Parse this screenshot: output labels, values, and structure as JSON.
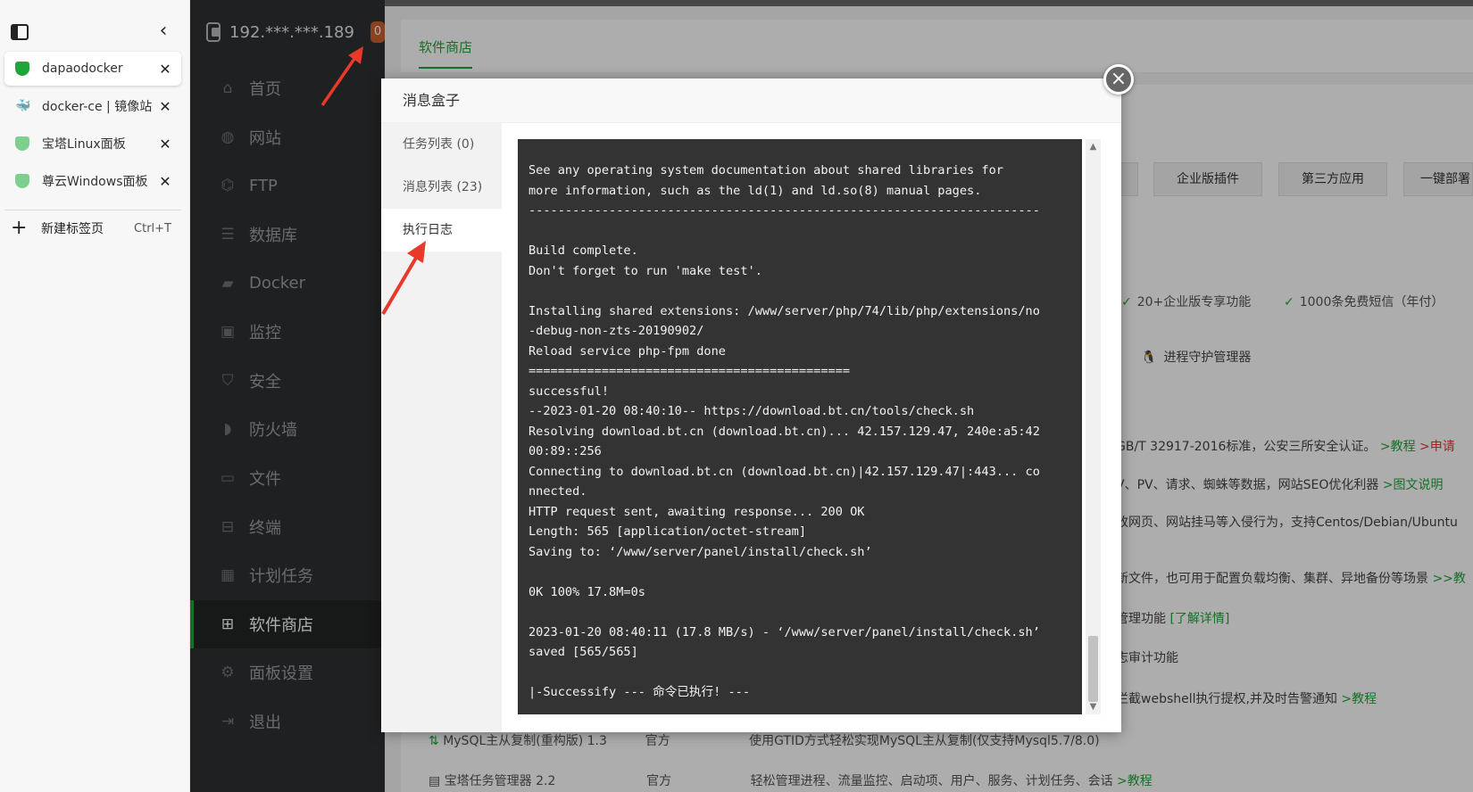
{
  "browser": {
    "tabs": [
      {
        "label": "dapaodocker",
        "icon": "bt-shield-icon",
        "active": true
      },
      {
        "label": "docker-ce | 镜像站",
        "icon": "docker-icon",
        "active": false
      },
      {
        "label": "宝塔Linux面板",
        "icon": "bt-shield-icon",
        "active": false
      },
      {
        "label": "尊云Windows面板",
        "icon": "bt-shield-icon",
        "active": false
      }
    ],
    "new_tab_label": "新建标签页",
    "new_tab_shortcut": "Ctrl+T"
  },
  "panel": {
    "server_ip": "192.***.***.189",
    "message_badge": "0",
    "nav": [
      {
        "label": "首页",
        "icon": "home-icon"
      },
      {
        "label": "网站",
        "icon": "globe-icon"
      },
      {
        "label": "FTP",
        "icon": "ftp-icon"
      },
      {
        "label": "数据库",
        "icon": "database-icon"
      },
      {
        "label": "Docker",
        "icon": "docker-icon"
      },
      {
        "label": "监控",
        "icon": "monitor-icon"
      },
      {
        "label": "安全",
        "icon": "shield-check-icon"
      },
      {
        "label": "防火墙",
        "icon": "firewall-icon"
      },
      {
        "label": "文件",
        "icon": "folder-icon"
      },
      {
        "label": "终端",
        "icon": "terminal-icon"
      },
      {
        "label": "计划任务",
        "icon": "calendar-icon"
      },
      {
        "label": "软件商店",
        "icon": "grid-icon",
        "active": true
      },
      {
        "label": "面板设置",
        "icon": "gear-icon"
      },
      {
        "label": "退出",
        "icon": "logout-icon"
      }
    ]
  },
  "store": {
    "tab_label": "软件商店",
    "categories": [
      "企业版插件",
      "第三方应用",
      "一键部署"
    ],
    "perks": [
      "20+企业版专享功能",
      "1000条免费短信（年付）"
    ],
    "pm2_label": "进程守护管理器",
    "bg_lines": [
      {
        "text": "GB/T 32917-2016标准，公安三所安全认证。",
        "link1": ">教程",
        "link2": ">申请"
      },
      {
        "text": "V、PV、请求、蜘蛛等数据，网站SEO优化利器",
        "link1": ">图文说明"
      },
      {
        "text": "改网页、网站挂马等入侵行为，支持Centos/Debian/Ubuntu"
      },
      {
        "text": "新文件，也可用于配置负载均衡、集群、异地备份等场景",
        "link1": ">>教"
      },
      {
        "text": "管理功能",
        "link1": "[了解详情]"
      },
      {
        "text": "志审计功能"
      },
      {
        "text": "拦截webshell执行提权,并及时告警通知",
        "link1": ">教程"
      }
    ],
    "rows": [
      {
        "name": "MySQL主从复制(重构版) 1.3",
        "type": "官方",
        "desc": "使用GTID方式轻松实现MySQL主从复制(仅支持Mysql5.7/8.0)"
      },
      {
        "name": "宝塔任务管理器 2.2",
        "type": "官方",
        "desc": "轻松管理进程、流量监控、启动项、用户、服务、计划任务、会话",
        "link": ">教程"
      }
    ]
  },
  "modal": {
    "title": "消息盒子",
    "close_label": "×",
    "side_items": [
      "任务列表 (0)",
      "消息列表 (23)",
      "执行日志"
    ],
    "log": "See any operating system documentation about shared libraries for\nmore information, such as the ld(1) and ld.so(8) manual pages.\n----------------------------------------------------------------------\n\nBuild complete.\nDon't forget to run 'make test'.\n\nInstalling shared extensions: /www/server/php/74/lib/php/extensions/no\n-debug-non-zts-20190902/\nReload service php-fpm done\n============================================\nsuccessful!\n--2023-01-20 08:40:10-- https://download.bt.cn/tools/check.sh\nResolving download.bt.cn (download.bt.cn)... 42.157.129.47, 240e:a5:42\n00:89::256\nConnecting to download.bt.cn (download.bt.cn)|42.157.129.47|:443... co\nnnected.\nHTTP request sent, awaiting response... 200 OK\nLength: 565 [application/octet-stream]\nSaving to: ‘/www/server/panel/install/check.sh’\n\n0K 100% 17.8M=0s\n\n2023-01-20 08:40:11 (17.8 MB/s) - ‘/www/server/panel/install/check.sh’\nsaved [565/565]\n\n|-Successify --- 命令已执行! ---"
  },
  "colors": {
    "accent": "#20a53a",
    "badge": "#c9622f",
    "arrow": "#e8392a",
    "terminal_bg": "#333333"
  }
}
